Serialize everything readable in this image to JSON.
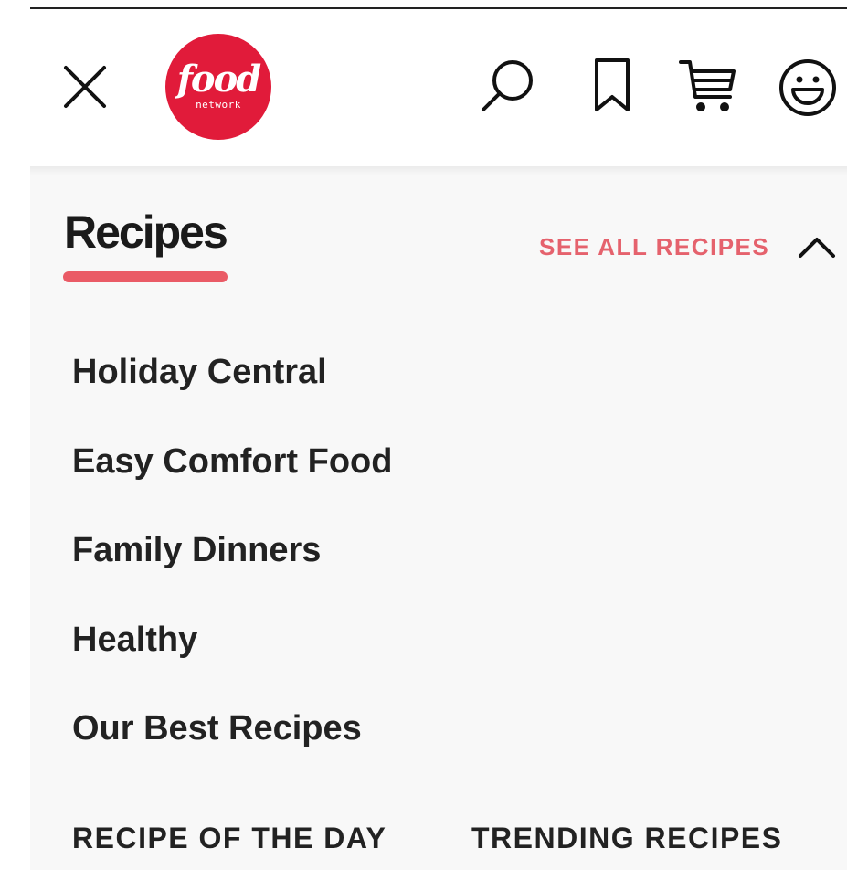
{
  "header": {
    "logo": {
      "word": "food",
      "sub": "network",
      "color": "#e11b3a"
    },
    "icons": [
      "close-icon",
      "search-icon",
      "bookmark-icon",
      "cart-icon",
      "profile-icon"
    ]
  },
  "menu": {
    "section_title": "Recipes",
    "see_all_label": "SEE ALL RECIPES",
    "accent_color": "#e5626d",
    "items": [
      {
        "label": "Holiday Central"
      },
      {
        "label": "Easy Comfort Food"
      },
      {
        "label": "Family Dinners"
      },
      {
        "label": "Healthy"
      },
      {
        "label": "Our Best Recipes"
      }
    ],
    "bottom_links": [
      {
        "label": "RECIPE OF THE DAY"
      },
      {
        "label": "TRENDING RECIPES"
      }
    ]
  }
}
